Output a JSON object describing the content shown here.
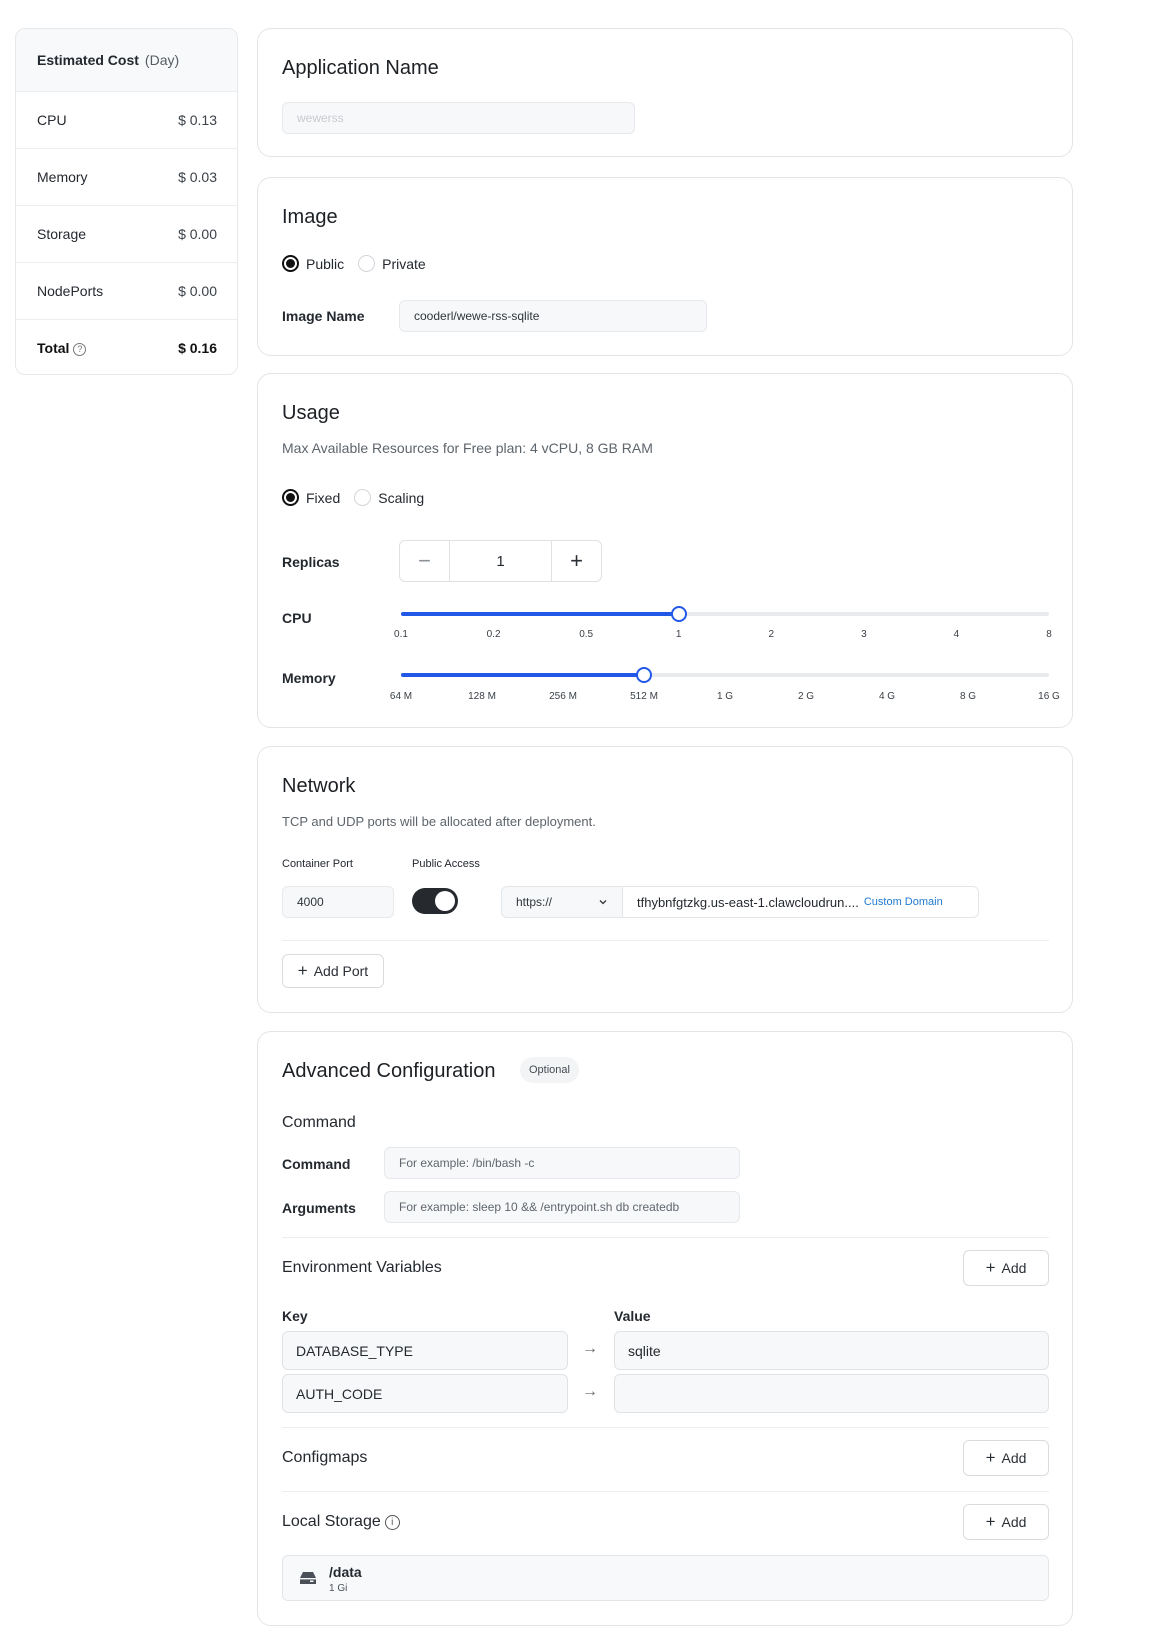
{
  "cost": {
    "title": "Estimated Cost",
    "period": "(Day)",
    "rows": [
      {
        "label": "CPU",
        "value": "$ 0.13"
      },
      {
        "label": "Memory",
        "value": "$ 0.03"
      },
      {
        "label": "Storage",
        "value": "$ 0.00"
      },
      {
        "label": "NodePorts",
        "value": "$ 0.00"
      }
    ],
    "total_label": "Total",
    "total_value": "$ 0.16",
    "help_glyph": "?"
  },
  "app": {
    "title": "Application Name",
    "name_value": "wewerss"
  },
  "image": {
    "title": "Image",
    "radio_public": "Public",
    "radio_private": "Private",
    "selected": "Public",
    "name_label": "Image Name",
    "name_value": "cooderl/wewe-rss-sqlite"
  },
  "usage": {
    "title": "Usage",
    "description": "Max Available Resources for Free plan: 4 vCPU, 8 GB RAM",
    "radio_fixed": "Fixed",
    "radio_scaling": "Scaling",
    "selected": "Fixed",
    "replicas_label": "Replicas",
    "replicas_value": "1",
    "minus_glyph": "−",
    "plus_glyph": "+",
    "cpu_label": "CPU",
    "cpu_ticks": [
      "0.1",
      "0.2",
      "0.5",
      "1",
      "2",
      "3",
      "4",
      "8"
    ],
    "cpu_selected": "1",
    "memory_label": "Memory",
    "memory_ticks": [
      "64 M",
      "128 M",
      "256 M",
      "512 M",
      "1 G",
      "2 G",
      "4 G",
      "8 G",
      "16 G"
    ],
    "memory_selected": "512 M",
    "accent_color": "#2158e8"
  },
  "network": {
    "title": "Network",
    "description": "TCP and UDP ports will be allocated after deployment.",
    "container_port_label": "Container Port",
    "public_access_label": "Public Access",
    "port_value": "4000",
    "public_access_enabled": true,
    "protocol": "https://",
    "domain": "tfhybnfgtzkg.us-east-1.clawcloudrun....",
    "custom_domain": "Custom Domain",
    "add_port": "Add Port"
  },
  "advanced": {
    "title": "Advanced Configuration",
    "badge": "Optional",
    "command_section": "Command",
    "command_label": "Command",
    "command_placeholder": "For example:  /bin/bash -c",
    "args_label": "Arguments",
    "args_placeholder": "For example:  sleep 10 && /entrypoint.sh db createdb",
    "env_title": "Environment Variables",
    "add_label": "Add",
    "key_header": "Key",
    "value_header": "Value",
    "env": [
      {
        "key": "DATABASE_TYPE",
        "value": "sqlite"
      },
      {
        "key": "AUTH_CODE",
        "value": ""
      }
    ],
    "configmaps_title": "Configmaps",
    "storage_title": "Local Storage",
    "info_glyph": "i",
    "storage": {
      "path": "/data",
      "size": "1 Gi"
    }
  }
}
